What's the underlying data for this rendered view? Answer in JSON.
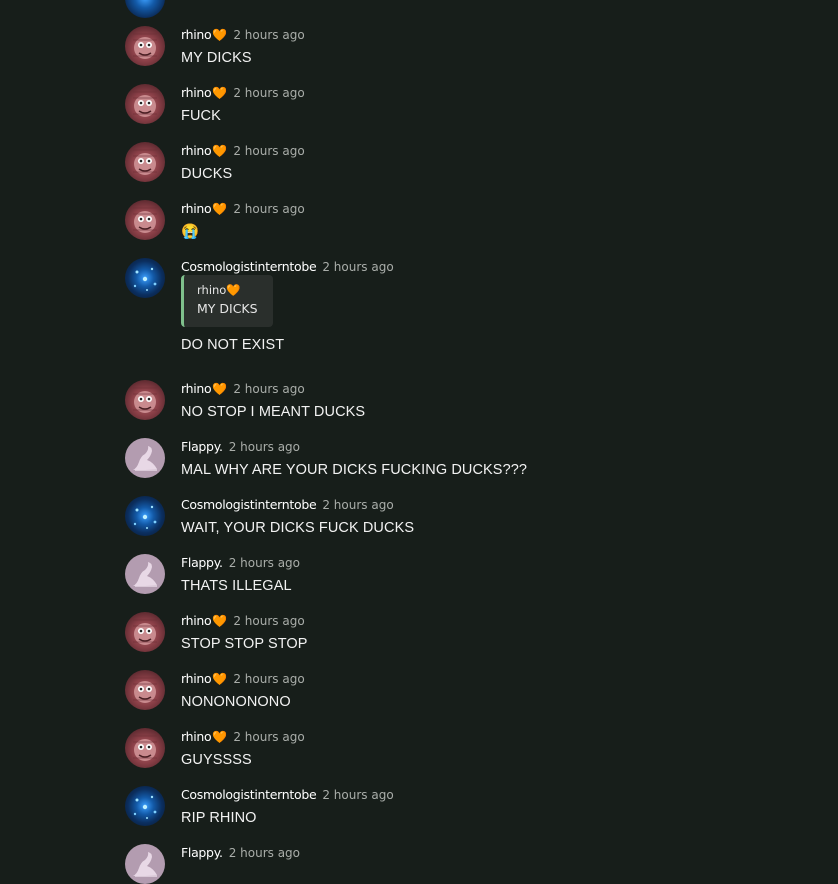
{
  "chat": {
    "messages": [
      {
        "author": "rhino",
        "heart": "🧡",
        "time": "2 hours ago",
        "text": "MY DICKS",
        "avatar": "rhino"
      },
      {
        "author": "rhino",
        "heart": "🧡",
        "time": "2 hours ago",
        "text": "FUCK",
        "avatar": "rhino"
      },
      {
        "author": "rhino",
        "heart": "🧡",
        "time": "2 hours ago",
        "text": "DUCKS",
        "avatar": "rhino"
      },
      {
        "author": "rhino",
        "heart": "🧡",
        "time": "2 hours ago",
        "text": "😭",
        "avatar": "rhino"
      },
      {
        "author": "Cosmologistinterntobe",
        "heart": "",
        "time": "2 hours ago",
        "text": "DO NOT EXIST",
        "avatar": "cosmo",
        "reply": {
          "author": "rhino🧡",
          "text": "MY DICKS"
        }
      },
      {
        "author": "rhino",
        "heart": "🧡",
        "time": "2 hours ago",
        "text": "NO STOP I MEANT DUCKS",
        "avatar": "rhino"
      },
      {
        "author": "Flappy.",
        "heart": "",
        "time": "2 hours ago",
        "text": "MAL WHY ARE YOUR DICKS FUCKING DUCKS???",
        "avatar": "flappy"
      },
      {
        "author": "Cosmologistinterntobe",
        "heart": "",
        "time": "2 hours ago",
        "text": "WAIT, YOUR DICKS FUCK DUCKS",
        "avatar": "cosmo"
      },
      {
        "author": "Flappy.",
        "heart": "",
        "time": "2 hours ago",
        "text": "THATS ILLEGAL",
        "avatar": "flappy"
      },
      {
        "author": "rhino",
        "heart": "🧡",
        "time": "2 hours ago",
        "text": "STOP STOP STOP",
        "avatar": "rhino"
      },
      {
        "author": "rhino",
        "heart": "🧡",
        "time": "2 hours ago",
        "text": "NONONONONO",
        "avatar": "rhino"
      },
      {
        "author": "rhino",
        "heart": "🧡",
        "time": "2 hours ago",
        "text": "GUYSSSS",
        "avatar": "rhino"
      },
      {
        "author": "Cosmologistinterntobe",
        "heart": "",
        "time": "2 hours ago",
        "text": "RIP RHINO",
        "avatar": "cosmo"
      },
      {
        "author": "Flappy.",
        "heart": "",
        "time": "2 hours ago",
        "text": "",
        "avatar": "flappy"
      }
    ]
  },
  "colors": {
    "background": "#171e1a",
    "reply_accent": "#7fc08c",
    "timestamp": "#a9ada9"
  }
}
